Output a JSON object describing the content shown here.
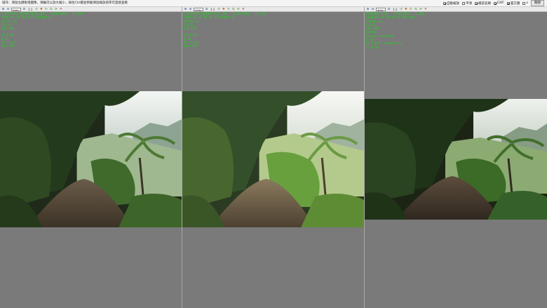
{
  "topbar": {
    "message": "操作：滑鼠左鍵拖曳圖像，滑輪可以放大縮小，按住Ctrl鍵並移動滑鼠縮放倍率可直接查看",
    "options": [
      {
        "label": "自動縮放",
        "checked": true
      },
      {
        "label": "平滑",
        "checked": false
      },
      {
        "label": "檔案名稱",
        "checked": true
      },
      {
        "label": "EXIF",
        "checked": true
      },
      {
        "label": "置方圖",
        "checked": true
      },
      {
        "label": "x",
        "checked": false
      }
    ],
    "close_button": "關閉"
  },
  "panels": [
    {
      "zoom": "20%",
      "ratio": "1:1",
      "info": [
        "A_DSC0001_NIKON D850.JPG , 8256x5504 , 15.3MB",
        "2020-04-18 10:46:33 NIKON Z6",
        "1/125 sec",
        "F/4.0",
        "ISO 100",
        "",
        "24.0 mm",
        "0 EV",
        "No flash",
        "Auto WB"
      ]
    },
    {
      "zoom": "22%",
      "ratio": "1:1",
      "info": [
        "B_DSC0002_NIKON D850.JPG , 8256x5504 , 16.7MB",
        "2020-04-18 10:46:35 NIKON Z6",
        "1/125 sec",
        "F/4.0",
        "ISO 100",
        "",
        "24.0 mm",
        "0 EV",
        "No flash",
        "Auto WB"
      ]
    },
    {
      "zoom": "40%",
      "ratio": "1:1",
      "info": [
        "P1040001.JPG , 5184x3456 , 9.2MB",
        "2020-04-18 10:47:02 DMC-GH5",
        "1/100 sec",
        "F/5.6",
        "ISO 200",
        "Normal",
        "Center weighted",
        "0 EV",
        "No flash, compulsory",
        "12.0 mm"
      ]
    }
  ]
}
